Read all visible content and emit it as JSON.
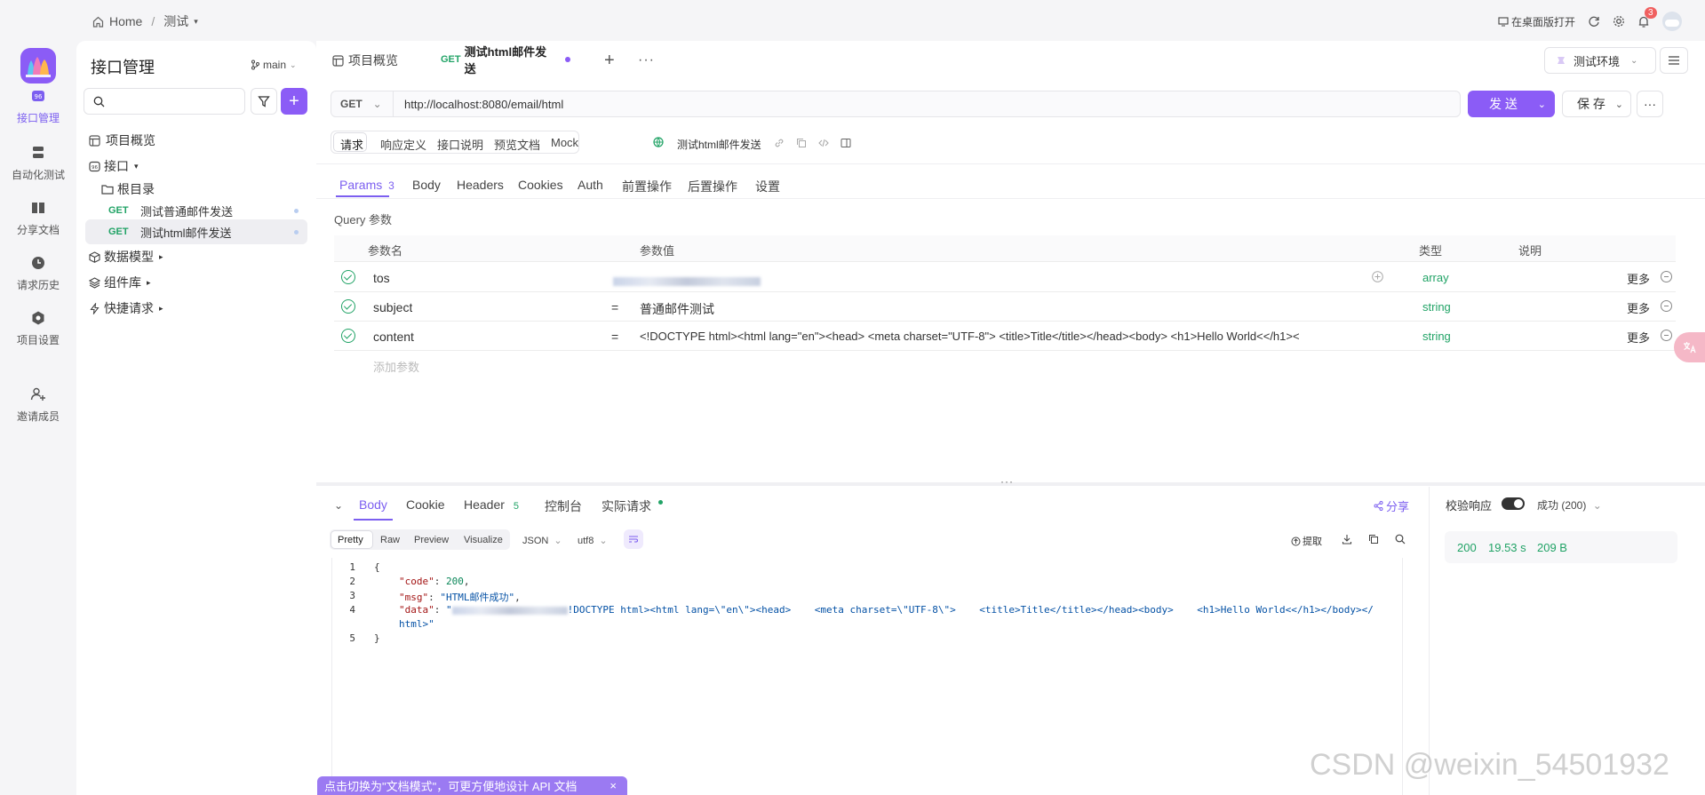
{
  "topbar": {
    "home": "Home",
    "project": "测试",
    "open_desktop": "在桌面版打开",
    "notification_count": "3"
  },
  "rail": {
    "items": [
      {
        "label": "接口管理"
      },
      {
        "label": "自动化测试"
      },
      {
        "label": "分享文档"
      },
      {
        "label": "请求历史"
      },
      {
        "label": "项目设置"
      },
      {
        "label": "邀请成员"
      }
    ]
  },
  "sidebar": {
    "title": "接口管理",
    "branch": "main",
    "overview": "项目概览",
    "interfaces": "接口",
    "root": "根目录",
    "apis": [
      {
        "method": "GET",
        "name": "测试普通邮件发送"
      },
      {
        "method": "GET",
        "name": "测试html邮件发送"
      }
    ],
    "data_model": "数据模型",
    "components": "组件库",
    "quick_request": "快捷请求"
  },
  "tabs": {
    "overview": "项目概览",
    "active_method": "GET",
    "active_name": "测试html邮件发送",
    "environment": "测试环境"
  },
  "request": {
    "method": "GET",
    "url": "http://localhost:8080/email/html",
    "send": "发 送",
    "save": "保 存"
  },
  "mode_tabs": [
    "请求",
    "响应定义",
    "接口说明",
    "预览文档",
    "Mock"
  ],
  "api_name": "测试html邮件发送",
  "param_tabs": {
    "params": "Params",
    "params_count": "3",
    "body": "Body",
    "headers": "Headers",
    "cookies": "Cookies",
    "auth": "Auth",
    "pre": "前置操作",
    "post": "后置操作",
    "settings": "设置"
  },
  "query": {
    "title": "Query 参数",
    "headers": {
      "name": "参数名",
      "value": "参数值",
      "type": "类型",
      "desc": "说明"
    },
    "rows": [
      {
        "name": "tos",
        "eq": "",
        "value": "",
        "type": "array",
        "more": "更多"
      },
      {
        "name": "subject",
        "eq": "=",
        "value": "普通邮件测试",
        "type": "string",
        "more": "更多"
      },
      {
        "name": "content",
        "eq": "=",
        "value": "<!DOCTYPE html><html lang=\"en\"><head>    <meta charset=\"UTF-8\">    <title>Title</title></head><body>    <h1>Hello World<</h1><",
        "type": "string",
        "more": "更多"
      }
    ],
    "add_placeholder": "添加参数"
  },
  "response": {
    "tabs": {
      "body": "Body",
      "cookie": "Cookie",
      "header": "Header",
      "header_count": "5",
      "console": "控制台",
      "actual": "实际请求"
    },
    "share": "分享",
    "formats": [
      "Pretty",
      "Raw",
      "Preview",
      "Visualize"
    ],
    "lang": "JSON",
    "encoding": "utf8",
    "extract": "提取",
    "code": {
      "l1": "{",
      "l2_key": "\"code\"",
      "l2_val": "200",
      "l3_key": "\"msg\"",
      "l3_val": "\"HTML邮件成功\"",
      "l4_key": "\"data\"",
      "l4_val": "!DOCTYPE html><html lang=\\\"en\\\"><head>    <meta charset=\\\"UTF-8\\\">    <title>Title</title></head><body>    <h1>Hello World<</h1></body></",
      "l4b": "html>\"",
      "l5": "}"
    },
    "line_numbers": [
      "1",
      "2",
      "3",
      "4",
      "5"
    ],
    "validate": "校验响应",
    "status_select": "成功 (200)",
    "status_code": "200",
    "time": "19.53 s",
    "size": "209 B"
  },
  "doc_mode_banner": "点击切换为\"文档模式\"，可更方便地设计 API 文档",
  "watermark": "CSDN @weixin_54501932",
  "colors": {
    "accent": "#7c5ff0",
    "get": "#21a366",
    "type": "#21a366"
  }
}
